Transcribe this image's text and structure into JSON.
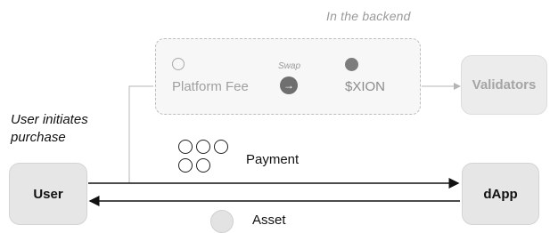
{
  "backend": {
    "caption": "In the backend",
    "platform_fee_label": "Platform Fee",
    "swap_label": "Swap",
    "token_label": "$XION",
    "arrow_glyph": "→"
  },
  "nodes": {
    "user": "User",
    "dapp": "dApp",
    "validators": "Validators"
  },
  "user_initiates": {
    "line1": "User initiates",
    "line2": "purchase"
  },
  "payment_label": "Payment",
  "asset_label": "Asset",
  "colors": {
    "node_fill": "#e6e6e6",
    "backend_fill": "#f7f7f7",
    "dashed_border": "#bdbdbd",
    "flow_line": "#111111",
    "backend_line": "#b5b5b5"
  }
}
